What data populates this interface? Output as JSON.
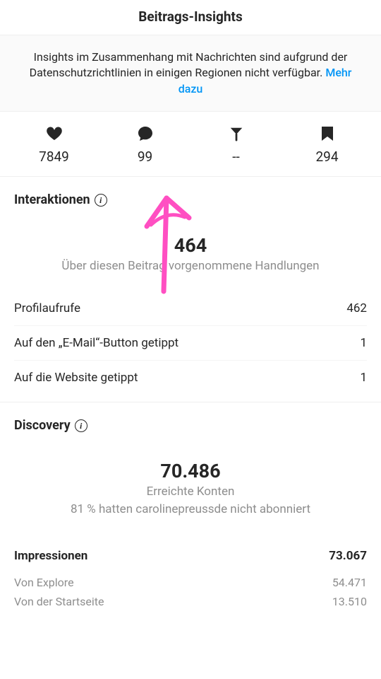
{
  "header": {
    "title": "Beitrags-Insights"
  },
  "notice": {
    "text": "Insights im Zusammenhang mit Nachrichten sind aufgrund der Datenschutzrichtlinien in einigen Regionen nicht verfügbar. ",
    "link_text": "Mehr dazu"
  },
  "stats": {
    "likes": "7849",
    "comments": "99",
    "shares": "--",
    "saves": "294"
  },
  "interactions": {
    "title": "Interaktionen",
    "total": "464",
    "total_sub": "Über diesen Beitrag vorgenommene Handlungen",
    "rows": [
      {
        "k": "Profilaufrufe",
        "v": "462"
      },
      {
        "k": "Auf den „E-Mail“-Button getippt",
        "v": "1"
      },
      {
        "k": "Auf die Website getippt",
        "v": "1"
      }
    ]
  },
  "discovery": {
    "title": "Discovery",
    "total": "70.486",
    "total_sub1": "Erreichte Konten",
    "total_sub2": "81 % hatten carolinepreussde nicht abonniert",
    "impressions": {
      "label": "Impressionen",
      "value": "73.067",
      "breakdown": [
        {
          "k": "Von Explore",
          "v": "54.471"
        },
        {
          "k": "Von der Startseite",
          "v": "13.510"
        }
      ]
    }
  }
}
